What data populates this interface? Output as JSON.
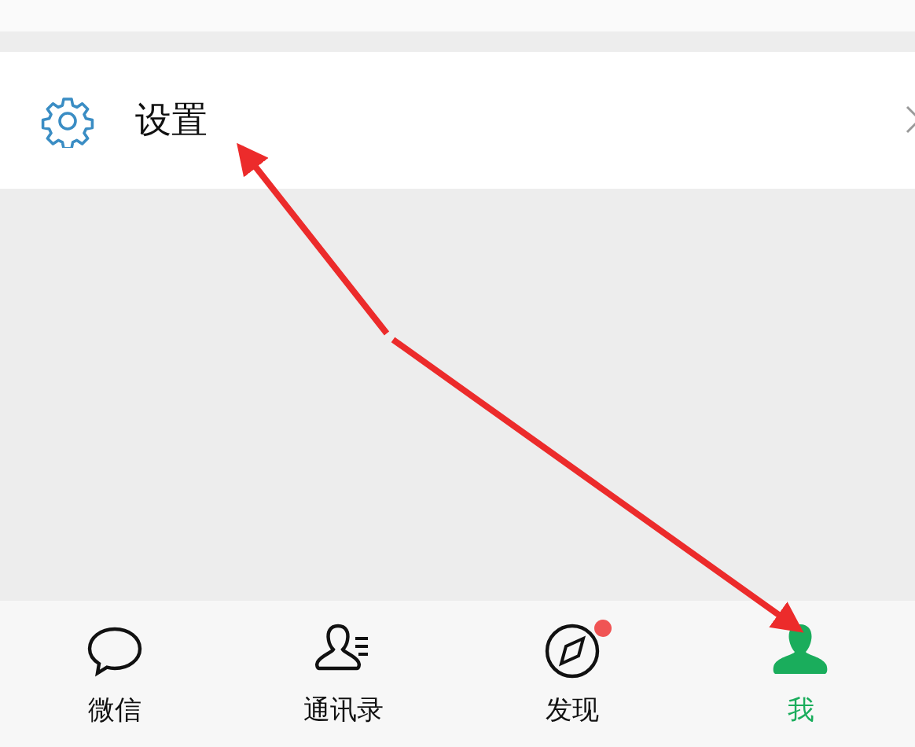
{
  "menu_item": {
    "label": "设置"
  },
  "tab_bar": {
    "tabs": [
      {
        "label": "微信",
        "kind": "chat",
        "selected": false,
        "dot": false
      },
      {
        "label": "通讯录",
        "kind": "contacts",
        "selected": false,
        "dot": false
      },
      {
        "label": "发现",
        "kind": "discover",
        "selected": false,
        "dot": true
      },
      {
        "label": "我",
        "kind": "me",
        "selected": true,
        "dot": false
      }
    ]
  }
}
